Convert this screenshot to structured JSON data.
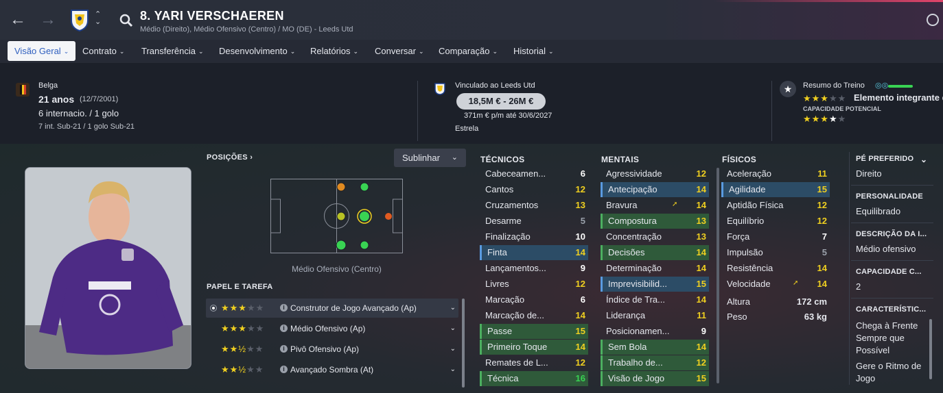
{
  "header": {
    "player_name": "8. YARI VERSCHAEREN",
    "player_subtitle": "Médio (Direito), Médio Ofensivo (Centro) / MO (DE) - Leeds Utd"
  },
  "tabs": [
    {
      "label": "Visão Geral"
    },
    {
      "label": "Contrato"
    },
    {
      "label": "Transferência"
    },
    {
      "label": "Desenvolvimento"
    },
    {
      "label": "Relatórios"
    },
    {
      "label": "Conversar"
    },
    {
      "label": "Comparação"
    },
    {
      "label": "Historial"
    }
  ],
  "info": {
    "nationality": "Belga",
    "age": "21 anos",
    "dob": "(12/7/2001)",
    "caps": "6 internacio. / 1 golo",
    "youth_caps": "7 int. Sub-21 / 1 golo Sub-21",
    "contract_club": "Vinculado ao Leeds Utd",
    "value": "18,5M € - 26M €",
    "wage": "371m € p/m até 30/6/2027",
    "status": "Estrela",
    "training_label": "Resumo do Treino",
    "training_text": "Elemento integrante d",
    "current_ability_stars": 3,
    "potential_label": "CAPACIDADE POTENCIAL",
    "potential_ability_stars": 3.5
  },
  "positions": {
    "label": "POSIÇÕES",
    "highlight_button": "Sublinhar",
    "caption": "Médio Ofensivo (Centro)"
  },
  "roles": {
    "label": "PAPEL E TAREFA",
    "items": [
      {
        "stars": "★★★☆☆",
        "name": "Construtor de Jogo Avançado (Ap)",
        "selected": true
      },
      {
        "stars": "★★★☆☆",
        "name": "Médio Ofensivo (Ap)",
        "selected": false
      },
      {
        "stars": "★★½☆☆",
        "name": "Pivô Ofensivo (Ap)",
        "selected": false
      },
      {
        "stars": "★★½☆☆",
        "name": "Avançado Sombra (At)",
        "selected": false
      }
    ]
  },
  "technical": {
    "label": "TÉCNICOS",
    "items": [
      {
        "name": "Cabeceamen...",
        "value": "6"
      },
      {
        "name": "Cantos",
        "value": "12"
      },
      {
        "name": "Cruzamentos",
        "value": "13"
      },
      {
        "name": "Desarme",
        "value": "5"
      },
      {
        "name": "Finalização",
        "value": "10"
      },
      {
        "name": "Finta",
        "value": "14"
      },
      {
        "name": "Lançamentos...",
        "value": "9"
      },
      {
        "name": "Livres",
        "value": "12"
      },
      {
        "name": "Marcação",
        "value": "6"
      },
      {
        "name": "Marcação de...",
        "value": "14"
      },
      {
        "name": "Passe",
        "value": "15"
      },
      {
        "name": "Primeiro Toque",
        "value": "14"
      },
      {
        "name": "Remates de L...",
        "value": "12"
      },
      {
        "name": "Técnica",
        "value": "16"
      }
    ]
  },
  "mental": {
    "label": "MENTAIS",
    "items": [
      {
        "name": "Agressividade",
        "value": "12"
      },
      {
        "name": "Antecipação",
        "value": "14"
      },
      {
        "name": "Bravura",
        "value": "14"
      },
      {
        "name": "Compostura",
        "value": "13"
      },
      {
        "name": "Concentração",
        "value": "13"
      },
      {
        "name": "Decisões",
        "value": "14"
      },
      {
        "name": "Determinação",
        "value": "14"
      },
      {
        "name": "Imprevisibilid...",
        "value": "15"
      },
      {
        "name": "Índice de Tra...",
        "value": "14"
      },
      {
        "name": "Liderança",
        "value": "11"
      },
      {
        "name": "Posicionamen...",
        "value": "9"
      },
      {
        "name": "Sem Bola",
        "value": "14"
      },
      {
        "name": "Trabalho de...",
        "value": "12"
      },
      {
        "name": "Visão de Jogo",
        "value": "15"
      }
    ]
  },
  "physical": {
    "label": "FÍSICOS",
    "items": [
      {
        "name": "Aceleração",
        "value": "11"
      },
      {
        "name": "Agilidade",
        "value": "15"
      },
      {
        "name": "Aptidão Física",
        "value": "12"
      },
      {
        "name": "Equilíbrio",
        "value": "12"
      },
      {
        "name": "Força",
        "value": "7"
      },
      {
        "name": "Impulsão",
        "value": "5"
      },
      {
        "name": "Resistência",
        "value": "14"
      },
      {
        "name": "Velocidade",
        "value": "14"
      }
    ],
    "height_label": "Altura",
    "height": "172 cm",
    "weight_label": "Peso",
    "weight": "63 kg"
  },
  "side": {
    "foot_label": "PÉ PREFERIDO",
    "foot": "Direito",
    "personality_label": "PERSONALIDADE",
    "personality": "Equilibrado",
    "description_label": "DESCRIÇÃO DA I...",
    "description": "Médio ofensivo",
    "capacity_label": "CAPACIDADE C...",
    "capacity": "2",
    "traits_label": "CARACTERÍSTIC...",
    "traits": [
      "Chega à Frente",
      "Sempre que",
      "Possível",
      "Gere o Ritmo de",
      "Jogo"
    ]
  },
  "colors": {
    "accent": "#f0d020",
    "good": "#39d353",
    "highlight_green": "#2f5a3a",
    "highlight_blue": "#2c4c66",
    "active_tab_text": "#2f5fbf"
  }
}
